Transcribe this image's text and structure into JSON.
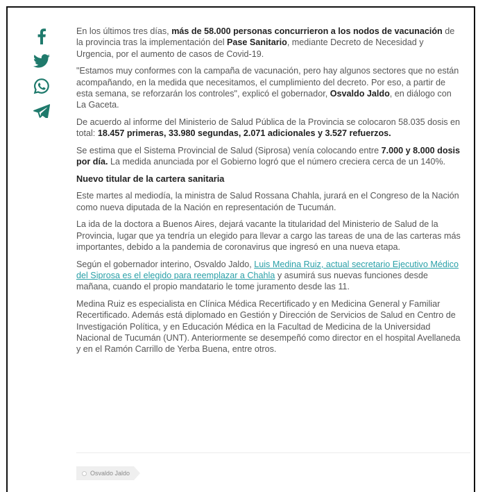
{
  "colors": {
    "accent": "#1f7a6c",
    "link": "#2aa0a8",
    "text": "#555555",
    "bold": "#222222"
  },
  "share": [
    {
      "name": "facebook-icon"
    },
    {
      "name": "twitter-icon"
    },
    {
      "name": "whatsapp-icon"
    },
    {
      "name": "telegram-icon"
    }
  ],
  "article": {
    "p1": {
      "a": "En los últimos tres días, ",
      "b": "más de 58.000 personas concurrieron a los nodos de vacunación",
      "c": " de la provincia tras la implementación del ",
      "d": "Pase Sanitario",
      "e": ", mediante Decreto de Necesidad y Urgencia, por el aumento de casos de Covid-19."
    },
    "p2": {
      "a": "\"Estamos muy conformes con la campaña de vacunación, pero hay algunos sectores que no están acompañando, en la medida que necesitamos, el cumplimiento del decreto. Por eso, a partir de esta semana, se reforzarán los controles\", explicó el gobernador, ",
      "b": "Osvaldo Jaldo",
      "c": ", en diálogo con La Gaceta."
    },
    "p3": {
      "a": "De acuerdo al informe del Ministerio de Salud Pública de la Provincia se colocaron 58.035 dosis en total: ",
      "b": "18.457 primeras, 33.980 segundas, 2.071 adicionales y 3.527 refuerzos."
    },
    "p4": {
      "a": "Se estima que el Sistema Provincial de Salud (Siprosa) venía colocando entre ",
      "b": "7.000 y 8.000 dosis por día.",
      "c": " La medida anunciada por el Gobierno logró que el número creciera cerca de un 140%."
    },
    "heading": "Nuevo titular de la cartera sanitaria",
    "p5": "Este martes al mediodía, la ministra de Salud Rossana Chahla, jurará en el Congreso de la Nación como nueva diputada de la Nación en representación de Tucumán.",
    "p6": "La ida de la doctora a Buenos Aires, dejará vacante la titularidad del Ministerio de Salud de la Provincia, lugar que ya tendría un elegido para llevar a cargo las tareas de una de las carteras más importantes, debido a la pandemia de coronavirus que ingresó en una nueva etapa.",
    "p7": {
      "a": "Según el gobernador interino, Osvaldo Jaldo, ",
      "link": "Luis Medina Ruiz, actual secretario Ejecutivo Médico del Siprosa es el elegido para reemplazar a Chahla",
      "c": " y asumirá sus nuevas funciones desde mañana, cuando el propio mandatario le tome juramento desde las 11."
    },
    "p8": "Medina Ruiz es especialista en Clínica Médica Recertificado y en Medicina General y Familiar Recertificado. Además está diplomado en Gestión y Dirección de Servicios de Salud en Centro de Investigación Política, y en Educación Médica en la Facultad de Medicina de la Universidad Nacional de Tucumán (UNT). Anteriormente se desempeñó como director en el hospital Avellaneda y en el Ramón Carrillo de Yerba Buena, entre otros."
  },
  "tag": {
    "label": "Osvaldo Jaldo"
  }
}
